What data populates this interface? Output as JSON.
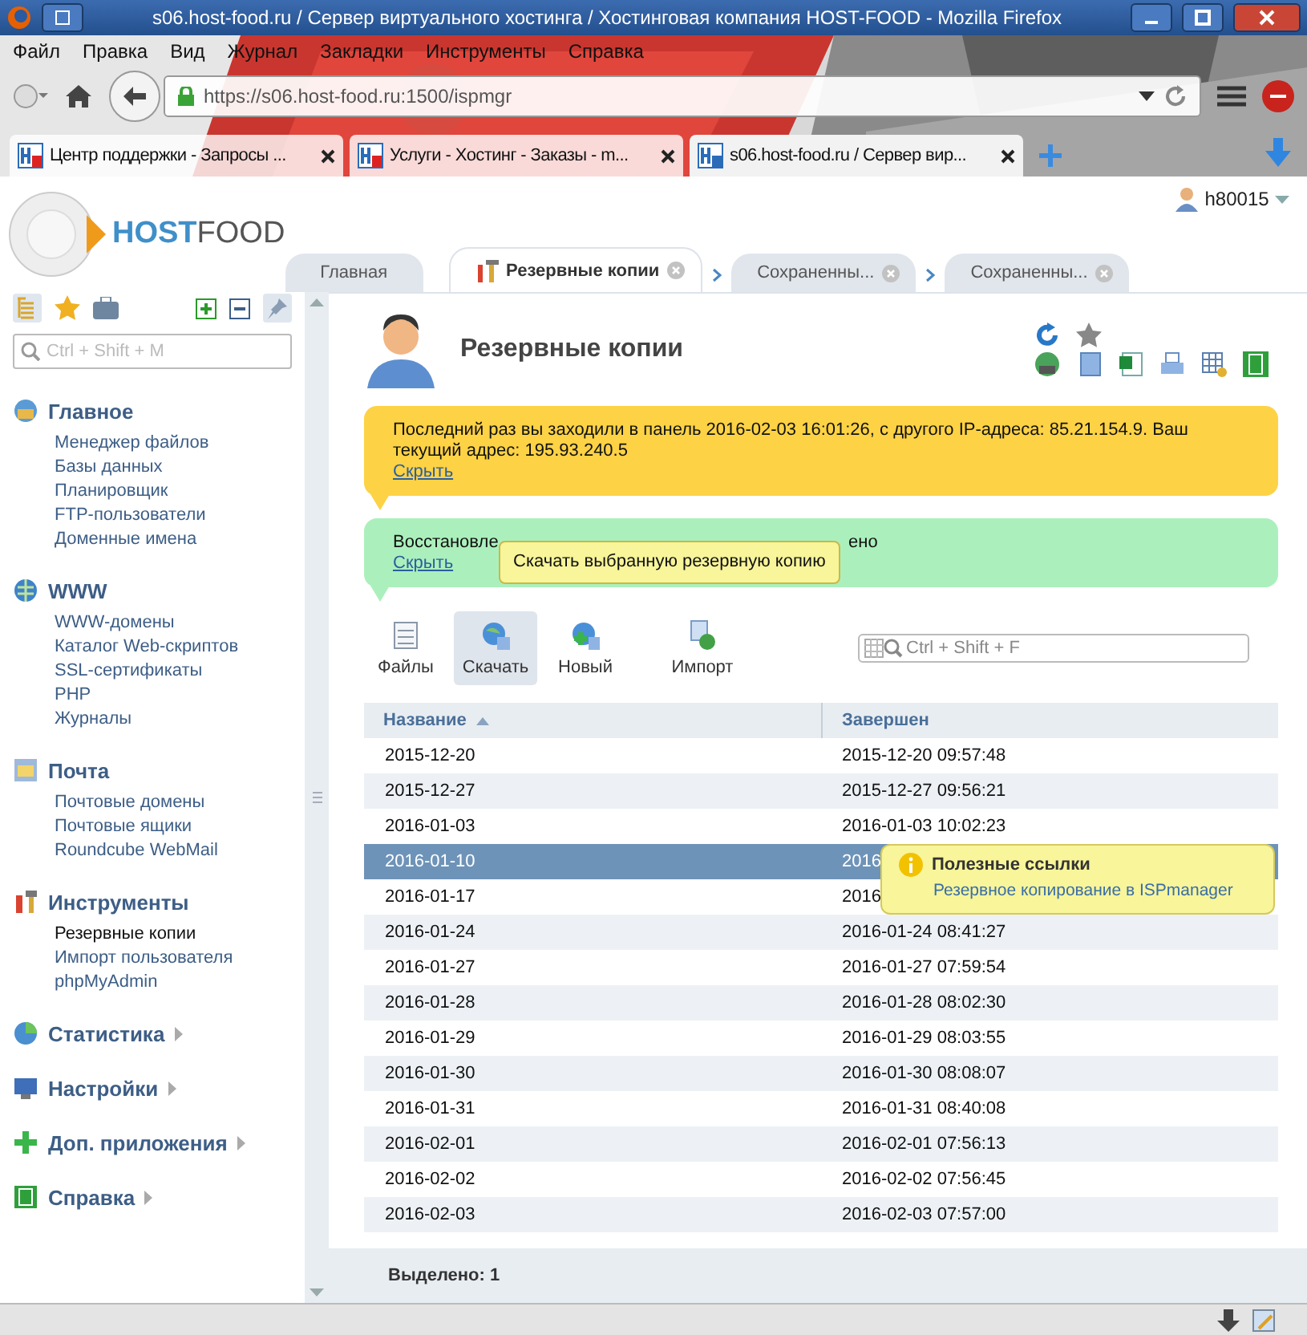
{
  "window": {
    "title": "s06.host-food.ru / Сервер виртуального хостинга / Хостинговая компания HOST-FOOD - Mozilla Firefox"
  },
  "menu": [
    "Файл",
    "Правка",
    "Вид",
    "Журнал",
    "Закладки",
    "Инструменты",
    "Справка"
  ],
  "address": {
    "url": "https://s06.host-food.ru:1500/ispmgr"
  },
  "browser_tabs": [
    {
      "label": "Центр поддержки - Запросы ...",
      "selected": false
    },
    {
      "label": "Услуги - Хостинг - Заказы - m...",
      "selected": false
    },
    {
      "label": "s06.host-food.ru / Сервер вир...",
      "selected": true
    }
  ],
  "logo": {
    "part_a": "HOST",
    "part_b": "FOOD"
  },
  "user": "h80015",
  "page_tabs": [
    {
      "label": "Главная",
      "selected": false,
      "closable": false
    },
    {
      "label": "Резервные копии",
      "selected": true,
      "closable": true
    },
    {
      "label": "Сохраненны...",
      "selected": false,
      "closable": true
    },
    {
      "label": "Сохраненны...",
      "selected": false,
      "closable": true
    }
  ],
  "sidebar": {
    "search_placeholder": "Ctrl + Shift + M",
    "groups": [
      {
        "title": "Главное",
        "expanded": true,
        "items": [
          {
            "label": "Менеджер файлов",
            "selected": false
          },
          {
            "label": "Базы данных",
            "selected": false
          },
          {
            "label": "Планировщик",
            "selected": false
          },
          {
            "label": "FTP-пользователи",
            "selected": false
          },
          {
            "label": "Доменные имена",
            "selected": false
          }
        ]
      },
      {
        "title": "WWW",
        "expanded": true,
        "items": [
          {
            "label": "WWW-домены",
            "selected": false
          },
          {
            "label": "Каталог Web-скриптов",
            "selected": false
          },
          {
            "label": "SSL-сертификаты",
            "selected": false
          },
          {
            "label": "PHP",
            "selected": false
          },
          {
            "label": "Журналы",
            "selected": false
          }
        ]
      },
      {
        "title": "Почта",
        "expanded": true,
        "items": [
          {
            "label": "Почтовые домены",
            "selected": false
          },
          {
            "label": "Почтовые ящики",
            "selected": false
          },
          {
            "label": "Roundcube WebMail",
            "selected": false
          }
        ]
      },
      {
        "title": "Инструменты",
        "expanded": true,
        "items": [
          {
            "label": "Резервные копии",
            "selected": true
          },
          {
            "label": "Импорт пользователя",
            "selected": false
          },
          {
            "label": "phpMyAdmin",
            "selected": false
          }
        ]
      },
      {
        "title": "Статистика",
        "expanded": false
      },
      {
        "title": "Настройки",
        "expanded": false
      },
      {
        "title": "Доп. приложения",
        "expanded": false
      },
      {
        "title": "Справка",
        "expanded": false
      }
    ]
  },
  "page": {
    "title": "Резервные копии"
  },
  "notices": [
    {
      "kind": "warning",
      "text": "Последний раз вы заходили в панель 2016-02-03 16:01:26, с другого IP-адреса: 85.21.154.9. Ваш текущий адрес: 195.93.240.5",
      "link": "Скрыть"
    },
    {
      "kind": "success",
      "text_start": "Восстановле",
      "text_end": "ено",
      "link": "Скрыть"
    }
  ],
  "tooltip": "Скачать выбранную резервную копию",
  "toolbar": [
    {
      "label": "Файлы",
      "hovered": false
    },
    {
      "label": "Скачать",
      "hovered": true
    },
    {
      "label": "Новый",
      "hovered": false
    },
    {
      "label": "Импорт",
      "hovered": false
    }
  ],
  "filter_placeholder": "Ctrl + Shift + F",
  "table": {
    "columns": [
      {
        "label": "Название",
        "sorted": true
      },
      {
        "label": "Завершен",
        "sorted": false
      }
    ],
    "rows": [
      {
        "name": "2015-12-20",
        "finished": "2015-12-20 09:57:48",
        "selected": false
      },
      {
        "name": "2015-12-27",
        "finished": "2015-12-27 09:56:21",
        "selected": false
      },
      {
        "name": "2016-01-03",
        "finished": "2016-01-03 10:02:23",
        "selected": false
      },
      {
        "name": "2016-01-10",
        "finished": "2016",
        "selected": true
      },
      {
        "name": "2016-01-17",
        "finished": "2016",
        "selected": false
      },
      {
        "name": "2016-01-24",
        "finished": "2016-01-24 08:41:27",
        "selected": false
      },
      {
        "name": "2016-01-27",
        "finished": "2016-01-27 07:59:54",
        "selected": false
      },
      {
        "name": "2016-01-28",
        "finished": "2016-01-28 08:02:30",
        "selected": false
      },
      {
        "name": "2016-01-29",
        "finished": "2016-01-29 08:03:55",
        "selected": false
      },
      {
        "name": "2016-01-30",
        "finished": "2016-01-30 08:08:07",
        "selected": false
      },
      {
        "name": "2016-01-31",
        "finished": "2016-01-31 08:40:08",
        "selected": false
      },
      {
        "name": "2016-02-01",
        "finished": "2016-02-01 07:56:13",
        "selected": false
      },
      {
        "name": "2016-02-02",
        "finished": "2016-02-02 07:56:45",
        "selected": false
      },
      {
        "name": "2016-02-03",
        "finished": "2016-02-03 07:57:00",
        "selected": false
      }
    ]
  },
  "footer": "Выделено: 1",
  "help_popup": {
    "title": "Полезные ссылки",
    "link": "Резервное копирование в ISPmanager"
  }
}
